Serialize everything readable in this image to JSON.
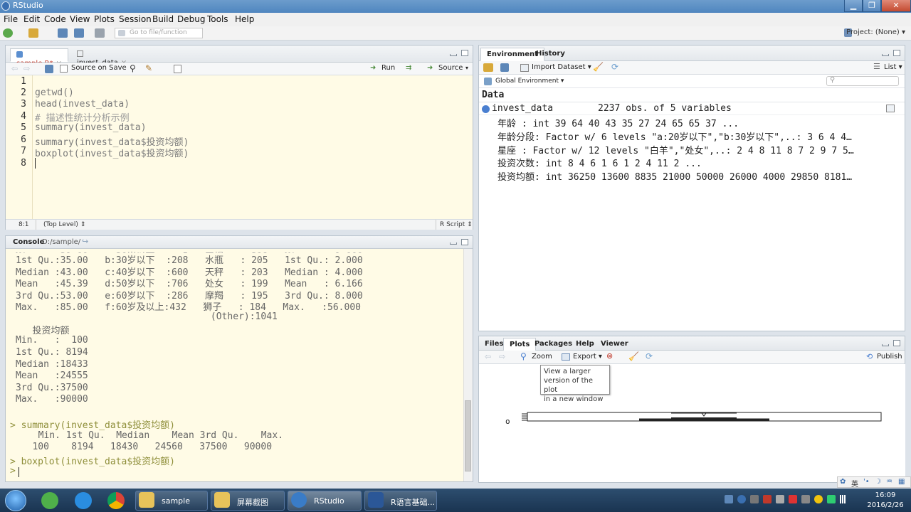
{
  "window": {
    "title": "RStudio",
    "minimize": "▁",
    "maximize": "❐",
    "close": "✕"
  },
  "menu": [
    "File",
    "Edit",
    "Code",
    "View",
    "Plots",
    "Session",
    "Build",
    "Debug",
    "Tools",
    "Help"
  ],
  "toolbar": {
    "goto_placeholder": "Go to file/function",
    "project": "Project: (None) ▾"
  },
  "editor": {
    "tabs": [
      {
        "label": "sample.R*"
      },
      {
        "label": "invest_data"
      }
    ],
    "source_on_save": "Source on Save",
    "run": "Run",
    "source": "Source",
    "line_numbers": [
      "1",
      "2",
      "3",
      "4",
      "5",
      "6",
      "7",
      "8"
    ],
    "lines": [
      "",
      "getwd()",
      "head(invest_data)",
      "# 描述性统计分析示例",
      "summary(invest_data)",
      "summary(invest_data$投资均额)",
      "boxplot(invest_data$投资均额)",
      ""
    ],
    "status": {
      "position": "8:1",
      "scope": "(Top Level) ⇕",
      "type": "R Script ⇕"
    }
  },
  "console": {
    "title": "Console",
    "path": "D:/sample/",
    "lines": [
      {
        "text": "1st Qu.:35.00   b:30岁以下  :208   水瓶   : 205   1st Qu.: 2.000",
        "cmd": false
      },
      {
        "text": "Median :43.00   c:40岁以下  :600   天秤   : 203   Median : 4.000",
        "cmd": false
      },
      {
        "text": "Mean   :45.39   d:50岁以下  :706   处女   : 199   Mean   : 6.166",
        "cmd": false
      },
      {
        "text": "3rd Qu.:53.00   e:60岁以下  :286   摩羯   : 195   3rd Qu.: 8.000",
        "cmd": false
      },
      {
        "text": "Max.   :85.00   f:60岁及以上:432   狮子   : 184   Max.   :56.000",
        "cmd": false
      },
      {
        "text": "                                   (Other):1041",
        "cmd": false
      },
      {
        "text": "   投资均额",
        "cmd": false
      },
      {
        "text": "Min.   :  100",
        "cmd": false
      },
      {
        "text": "1st Qu.: 8194",
        "cmd": false
      },
      {
        "text": "Median :18433",
        "cmd": false
      },
      {
        "text": "Mean   :24555",
        "cmd": false
      },
      {
        "text": "3rd Qu.:37500",
        "cmd": false
      },
      {
        "text": "Max.   :90000",
        "cmd": false
      },
      {
        "text": "",
        "cmd": false
      },
      {
        "text": "> summary(invest_data$投资均额)",
        "cmd": true
      },
      {
        "text": "  Min. 1st Qu.  Median    Mean 3rd Qu.    Max.",
        "cmd": false
      },
      {
        "text": "   100    8194   18430   24560   37500   90000",
        "cmd": false
      },
      {
        "text": "> boxplot(invest_data$投资均额)",
        "cmd": true
      },
      {
        "text": ">",
        "cmd": true
      }
    ]
  },
  "environment": {
    "tabs": [
      {
        "label": "Environment"
      },
      {
        "label": "History"
      }
    ],
    "import": "Import Dataset ▾",
    "list": "List ▾",
    "scope": "Global Environment ▾",
    "section": "Data",
    "object": {
      "name": "invest_data",
      "desc": "2237 obs. of 5 variables"
    },
    "rows": [
      "年龄 : int 39 64 40 43 35 27 24 65 65 37 ...",
      "年龄分段: Factor w/ 6 levels \"a:20岁以下\",\"b:30岁以下\",..: 3 6 4 4…",
      "星座 : Factor w/ 12 levels \"白羊\",\"处女\",..: 2 4 8 11 8 7 2 9 7 5…",
      "投资次数: int 8 4 6 1 6 1 2 4 11 2 ...",
      "投资均额: int 36250 13600 8835 21000 50000 26000 4000 29850 8181…"
    ]
  },
  "files": {
    "tabs": [
      {
        "label": "Files"
      },
      {
        "label": "Plots"
      },
      {
        "label": "Packages"
      },
      {
        "label": "Help"
      },
      {
        "label": "Viewer"
      }
    ],
    "zoom": "Zoom",
    "export": "Export ▾",
    "publish": "Publish",
    "tooltip": [
      "View a larger",
      "version of the plot",
      "in a new window"
    ],
    "outlier_label": "o"
  },
  "taskbar": {
    "items": [
      {
        "label": "sample"
      },
      {
        "label": "屏幕截图"
      },
      {
        "label": "RStudio"
      },
      {
        "label": "R语言基础..."
      }
    ],
    "ime": "英",
    "time": "16:09",
    "date": "2016/2/26"
  },
  "colors": {
    "accent": "#4f86bf",
    "editor_bg": "#fffbe6",
    "taskbar": "#1a3451"
  }
}
